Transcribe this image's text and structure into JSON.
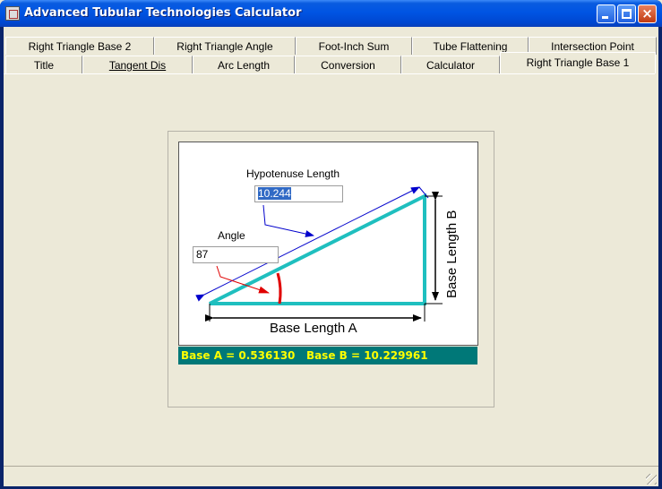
{
  "window": {
    "title": "Advanced Tubular Technologies Calculator",
    "controls": {
      "minimize": "minimize",
      "maximize": "maximize",
      "close": "×"
    }
  },
  "tabs": {
    "row1": [
      "Right Triangle Base 2",
      "Right Triangle Angle",
      "Foot-Inch Sum",
      "Tube Flattening",
      "Intersection Point"
    ],
    "row2": [
      "Title",
      "Tangent Dis",
      "Arc Length",
      "Conversion",
      "Calculator",
      "Right Triangle Base 1"
    ],
    "active": "Right Triangle Base 1"
  },
  "diagram": {
    "hypotenuse_label": "Hypotenuse Length",
    "hypotenuse_value": "10.244",
    "angle_label": "Angle",
    "angle_value": "87",
    "base_a_label": "Base Length A",
    "base_b_label": "Base Length B",
    "colors": {
      "triangle": "#1fbfbf",
      "arrow": "#0000cc",
      "angle_arc": "#e00000",
      "result_bg": "#007878",
      "result_text": "#ffff00"
    }
  },
  "result": {
    "text": "Base A = 0.536130   Base B = 10.229961"
  }
}
